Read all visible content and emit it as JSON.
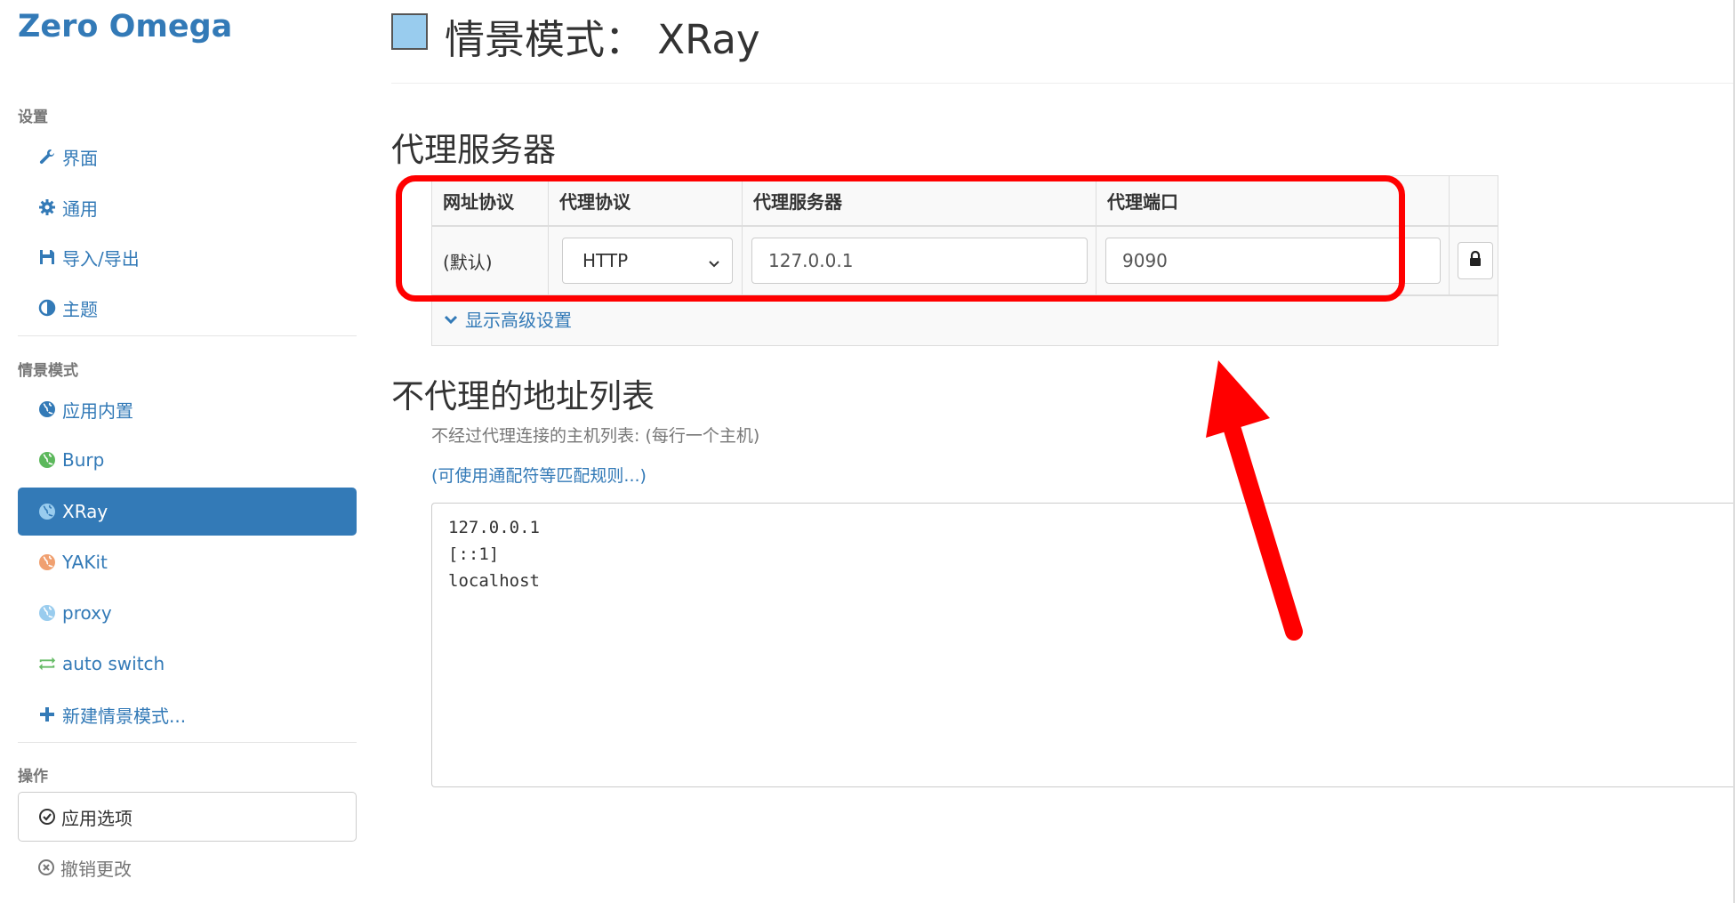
{
  "sidebar": {
    "brand": "Zero Omega",
    "section_settings": "设置",
    "settings_items": [
      {
        "label": "界面",
        "icon": "wrench-icon"
      },
      {
        "label": "通用",
        "icon": "gear-icon"
      },
      {
        "label": "导入/导出",
        "icon": "floppy-disk-icon"
      },
      {
        "label": "主题",
        "icon": "contrast-icon"
      }
    ],
    "section_profiles": "情景模式",
    "profiles": [
      {
        "label": "应用内置",
        "icon": "globe-icon",
        "color": "#337ab7"
      },
      {
        "label": "Burp",
        "icon": "globe-icon",
        "color": "#5cb85c"
      },
      {
        "label": "XRay",
        "icon": "globe-icon",
        "color": "#99ccee",
        "active": true
      },
      {
        "label": "YAKit",
        "icon": "globe-icon",
        "color": "#f0a070"
      },
      {
        "label": "proxy",
        "icon": "globe-icon",
        "color": "#99ccee"
      },
      {
        "label": "auto switch",
        "icon": "switch-arrows-icon",
        "color": "#66bb66"
      },
      {
        "label": "新建情景模式...",
        "icon": "plus-icon",
        "color": "#337ab7"
      }
    ],
    "section_actions": "操作",
    "apply_label": "应用选项",
    "discard_label": "撤销更改"
  },
  "main": {
    "title": "情景模式： XRay",
    "profile_color": "#99ccee",
    "proxy_section_title": "代理服务器",
    "table": {
      "headers": [
        "网址协议",
        "代理协议",
        "代理服务器",
        "代理端口"
      ],
      "row": {
        "scheme": "(默认)",
        "protocol": "HTTP",
        "server": "127.0.0.1",
        "port": "9090"
      },
      "advanced_link": "显示高级设置"
    },
    "bypass_section_title": "不代理的地址列表",
    "bypass_hint": "不经过代理连接的主机列表: (每行一个主机)",
    "wildcard_link": "(可使用通配符等匹配规则...)",
    "bypass_list": "127.0.0.1\n[::1]\nlocalhost"
  },
  "annotation_color": "#ff0000"
}
